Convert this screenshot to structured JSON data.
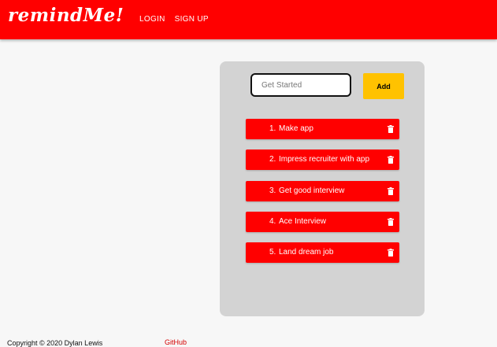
{
  "header": {
    "brand": "remindMe!",
    "nav": [
      {
        "label": "LOGIN"
      },
      {
        "label": "SIGN UP"
      }
    ]
  },
  "task_form": {
    "placeholder": "Get Started",
    "value": "",
    "add_label": "Add"
  },
  "tasks": [
    {
      "number": "1.",
      "text": "Make app"
    },
    {
      "number": "2.",
      "text": "Impress recruiter with app"
    },
    {
      "number": "3.",
      "text": "Get good interview"
    },
    {
      "number": "4.",
      "text": "Ace Interview"
    },
    {
      "number": "5.",
      "text": "Land dream job"
    }
  ],
  "footer": {
    "copyright": "Copyright © 2020 Dylan Lewis",
    "link": "GitHub"
  },
  "icons": {
    "delete": "trash-icon"
  },
  "colors": {
    "primary": "#ff0000",
    "accent": "#ffc200",
    "card": "#d3d3d3"
  }
}
